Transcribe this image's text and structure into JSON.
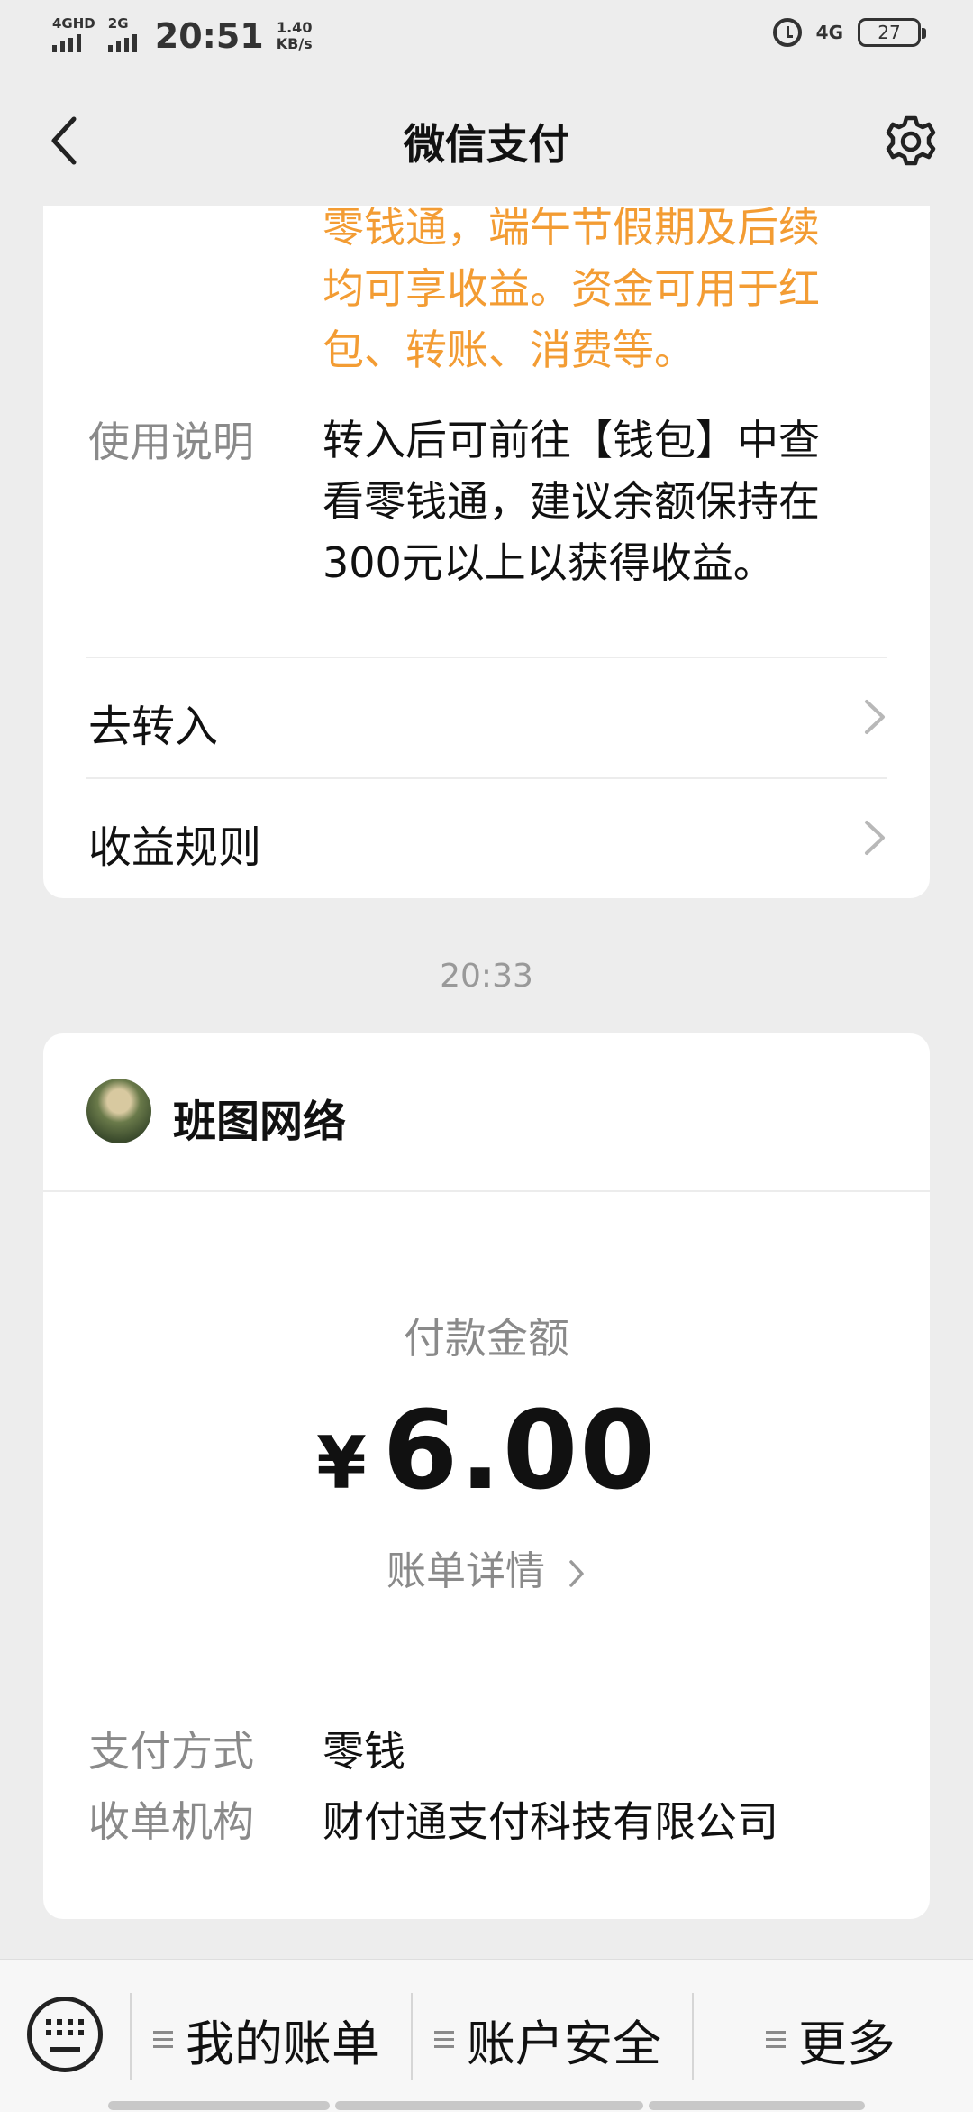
{
  "status_bar": {
    "net1": "4GHD",
    "net2": "2G",
    "time": "20:51",
    "speed_value": "1.40",
    "speed_unit": "KB/s",
    "net_right": "4G",
    "battery": "27",
    "icons": [
      "alarm-icon",
      "battery-icon"
    ]
  },
  "nav": {
    "title": "微信支付",
    "back_icon": "chevron-left-icon",
    "settings_icon": "gear-icon"
  },
  "card1": {
    "promo_lines": [
      "零钱通，端午节假期及后续",
      "均可享收益。资金可用于红",
      "包、转账、消费等。"
    ],
    "usage_key": "使用说明",
    "usage_lines": [
      "转入后可前往【钱包】中查",
      "看零钱通，建议余额保持在",
      "300元以上以获得收益。"
    ],
    "link1": "去转入",
    "link2": "收益规则"
  },
  "timestamp": "20:33",
  "card2": {
    "merchant": "班图网络",
    "pay_label": "付款金额",
    "currency": "¥",
    "amount": "6.00",
    "bill_detail": "账单详情",
    "pay_method_key": "支付方式",
    "pay_method_value": "零钱",
    "acquirer_key": "收单机构",
    "acquirer_value": "财付通支付科技有限公司"
  },
  "bottom_menu": {
    "items": [
      "我的账单",
      "账户安全",
      "更多"
    ]
  },
  "colors": {
    "accent_orange": "#f39c33",
    "background": "#ededed"
  }
}
